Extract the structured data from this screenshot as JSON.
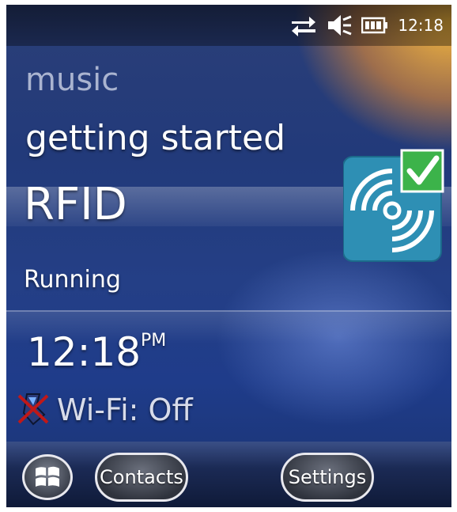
{
  "status_bar": {
    "time": "12:18",
    "icons": [
      "sync-arrows-icon",
      "speaker-muted-icon",
      "battery-icon"
    ]
  },
  "home": {
    "app_title": "music",
    "subtitle": "getting started",
    "selected_item": "RFID",
    "selected_status": "Running",
    "app_icon": "rfid-check-icon",
    "clock": "12:18",
    "ampm": "PM",
    "wifi_status": "Wi-Fi: Off",
    "wifi_icon": "wifi-off-icon"
  },
  "softkeys": {
    "start_icon": "windows-start-icon",
    "left": "Contacts",
    "right": "Settings"
  },
  "colors": {
    "accent_orange": "#ffbe3c",
    "background_blue": "#223a7a",
    "rfid_icon_blue": "#2e8fb4",
    "check_green": "#3cb34a"
  }
}
